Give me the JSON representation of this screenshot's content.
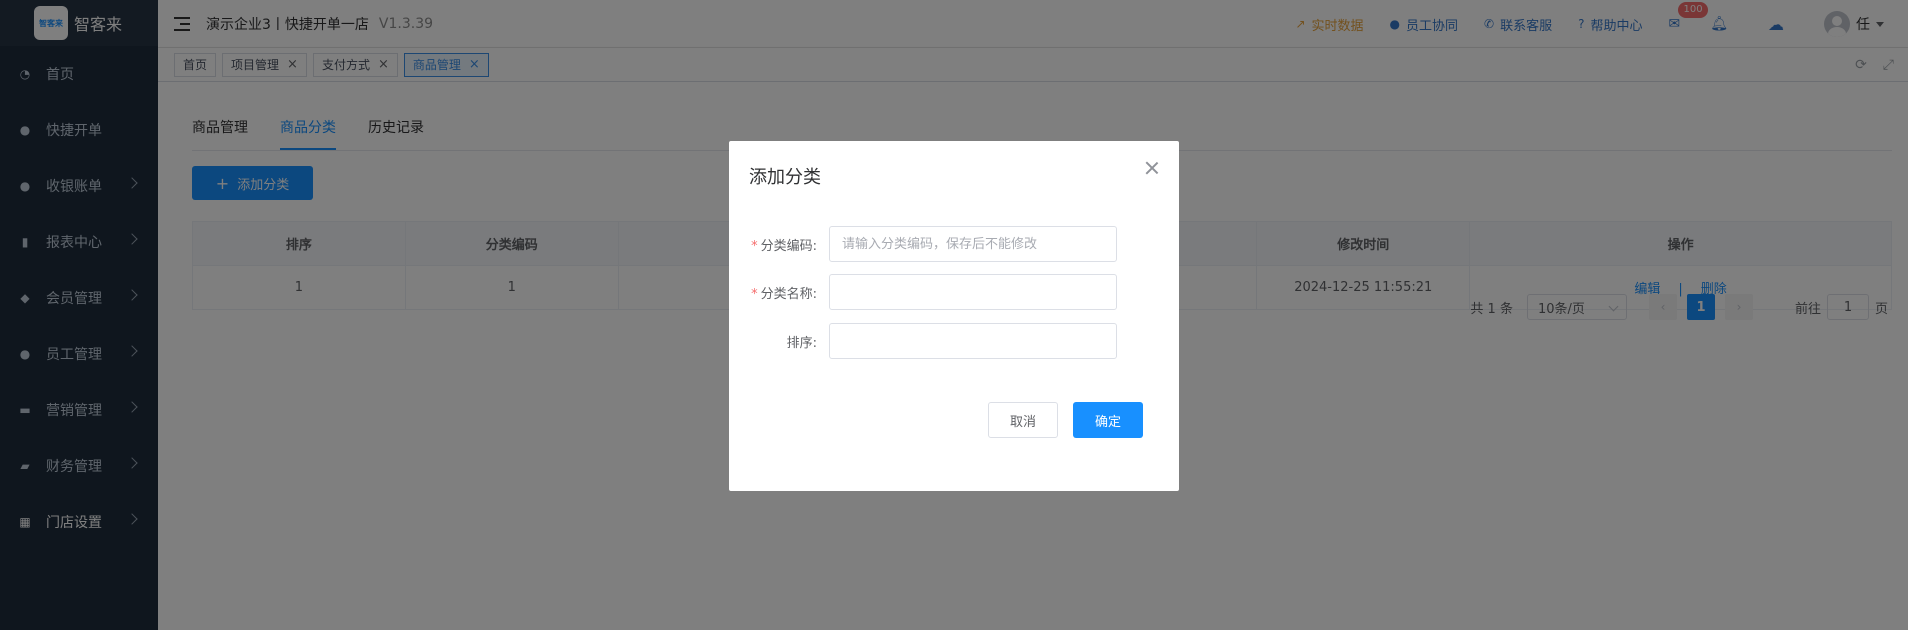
{
  "brand": {
    "logo_text": "智客来",
    "name": "智客来"
  },
  "sidebar": {
    "items": [
      {
        "label": "首页",
        "icon": "dashboard-icon",
        "has_arrow": false
      },
      {
        "label": "快捷开单",
        "icon": "money-bag-icon",
        "has_arrow": false
      },
      {
        "label": "收银账单",
        "icon": "money-bag-icon",
        "has_arrow": true
      },
      {
        "label": "报表中心",
        "icon": "bar-chart-icon",
        "has_arrow": true
      },
      {
        "label": "会员管理",
        "icon": "diamond-icon",
        "has_arrow": true
      },
      {
        "label": "员工管理",
        "icon": "user-icon",
        "has_arrow": true
      },
      {
        "label": "营销管理",
        "icon": "briefcase-icon",
        "has_arrow": true
      },
      {
        "label": "财务管理",
        "icon": "wallet-icon",
        "has_arrow": true
      },
      {
        "label": "门店设置",
        "icon": "grid-icon",
        "has_arrow": true
      }
    ]
  },
  "header": {
    "shop_name": "演示企业3丨快捷开单一店",
    "version": "V1.3.39",
    "links": {
      "realtime": "实时数据",
      "staff_collab": "员工协同",
      "support": "联系客服",
      "help": "帮助中心"
    },
    "mail_badge": "100",
    "user_name": "任"
  },
  "tags": [
    {
      "label": "首页",
      "closable": false,
      "active": false
    },
    {
      "label": "项目管理",
      "closable": true,
      "active": false
    },
    {
      "label": "支付方式",
      "closable": true,
      "active": false
    },
    {
      "label": "商品管理",
      "closable": true,
      "active": true
    }
  ],
  "main": {
    "tabs": [
      "商品管理",
      "商品分类",
      "历史记录"
    ],
    "active_tab": "商品分类",
    "add_button": "添加分类",
    "table": {
      "headers": [
        "排序",
        "分类编码",
        "",
        "",
        "修改时间",
        "操作"
      ],
      "rows": [
        {
          "sort": "1",
          "code": "1",
          "c3": "",
          "c4": "",
          "modified": "2024-12-25 11:55:21"
        }
      ],
      "ops": {
        "edit": "编辑",
        "sep": "|",
        "delete": "删除"
      }
    },
    "pagination": {
      "total": "共 1 条",
      "page_size": "10条/页",
      "current": "1",
      "goto_label": "前往",
      "goto_value": "1",
      "page_unit": "页"
    }
  },
  "dialog": {
    "title": "添加分类",
    "fields": {
      "code_label": "分类编码:",
      "code_placeholder": "请输入分类编码，保存后不能修改",
      "name_label": "分类名称:",
      "sort_label": "排序:"
    },
    "cancel": "取消",
    "confirm": "确定"
  },
  "colors": {
    "sidebar_bg": "#1f2d3d",
    "primary": "#1890ff",
    "realtime_link": "#e6a23c",
    "badge": "#f56c6c"
  }
}
